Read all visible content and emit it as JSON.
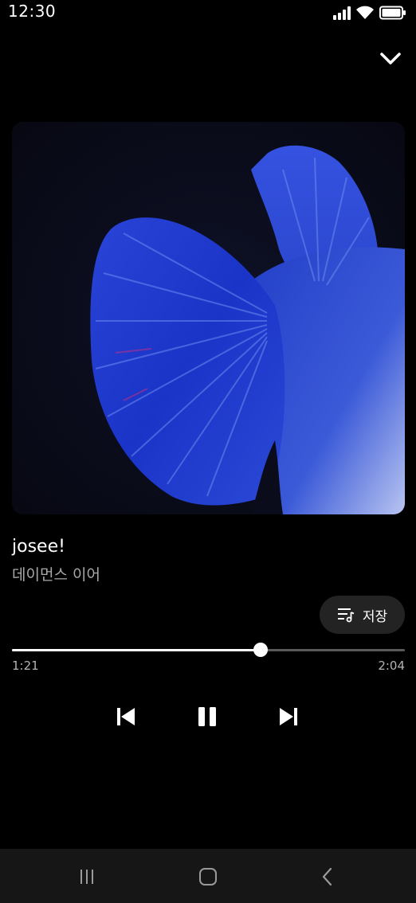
{
  "status_bar": {
    "time": "12:30",
    "icons": [
      "signal-icon",
      "wifi-icon",
      "battery-icon"
    ]
  },
  "header": {
    "collapse_icon": "chevron-down-icon"
  },
  "track": {
    "title": "josee!",
    "artist": "데이먼스 이어"
  },
  "save_button": {
    "icon": "playlist-add-icon",
    "label": "저장"
  },
  "playback": {
    "elapsed": "1:21",
    "duration": "2:04",
    "progress_fraction": 0.632
  },
  "controls": {
    "previous_icon": "skip-previous-icon",
    "play_pause_icon": "pause-icon",
    "next_icon": "skip-next-icon"
  },
  "nav_bar": {
    "items": [
      "recent-apps-icon",
      "home-icon",
      "back-icon"
    ]
  },
  "colors": {
    "background": "#000000",
    "accent": "#ffffff",
    "secondary_text": "#a9a9a9",
    "button_bg": "#232323"
  }
}
